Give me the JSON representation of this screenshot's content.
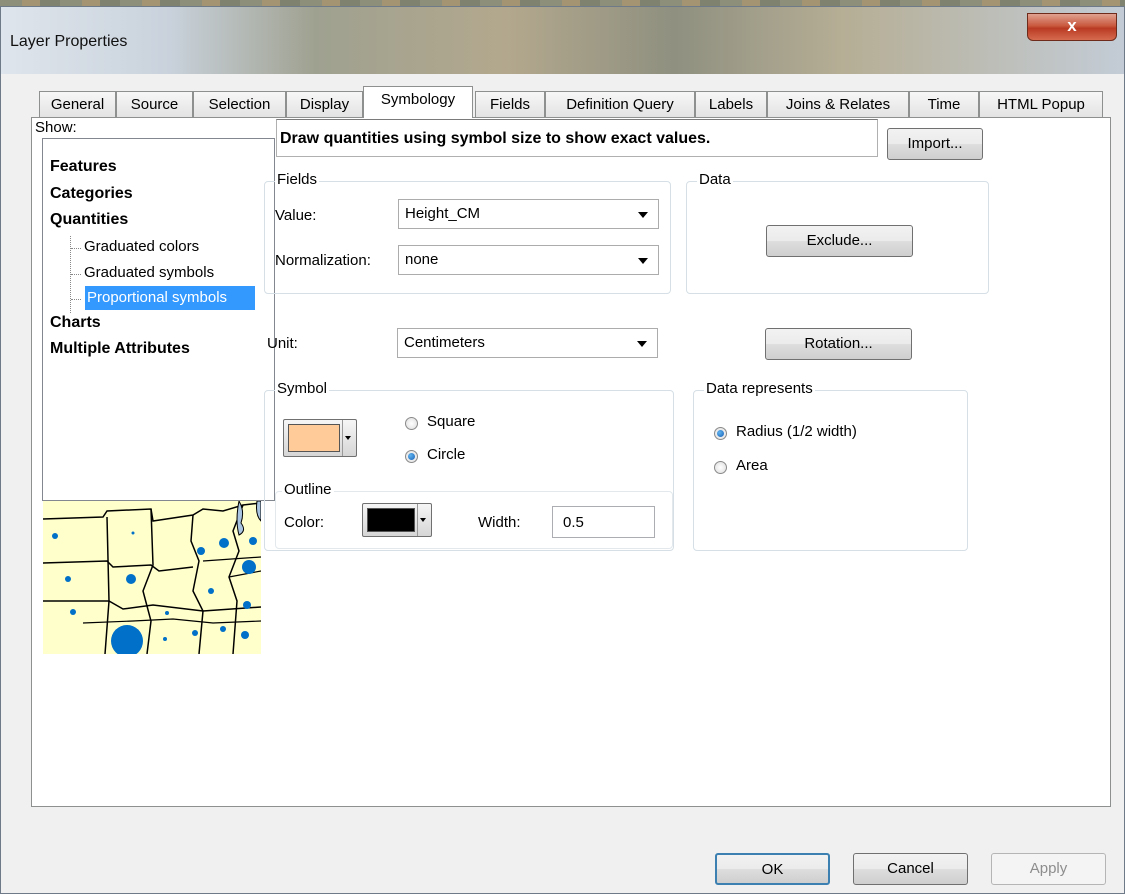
{
  "window": {
    "title": "Layer Properties",
    "close_glyph": "x",
    "close_color": "#c9593f"
  },
  "tabs": [
    {
      "label": "General",
      "active": false
    },
    {
      "label": "Source",
      "active": false
    },
    {
      "label": "Selection",
      "active": false
    },
    {
      "label": "Display",
      "active": false
    },
    {
      "label": "Symbology",
      "active": true
    },
    {
      "label": "Fields",
      "active": false
    },
    {
      "label": "Definition Query",
      "active": false
    },
    {
      "label": "Labels",
      "active": false
    },
    {
      "label": "Joins & Relates",
      "active": false
    },
    {
      "label": "Time",
      "active": false
    },
    {
      "label": "HTML Popup",
      "active": false
    }
  ],
  "show": {
    "label": "Show:",
    "items": [
      {
        "label": "Features",
        "level": 0
      },
      {
        "label": "Categories",
        "level": 0
      },
      {
        "label": "Quantities",
        "level": 0
      },
      {
        "label": "Graduated colors",
        "level": 1
      },
      {
        "label": "Graduated symbols",
        "level": 1
      },
      {
        "label": "Proportional symbols",
        "level": 1,
        "selected": true
      },
      {
        "label": "Charts",
        "level": 0
      },
      {
        "label": "Multiple Attributes",
        "level": 0
      }
    ],
    "selection_color": "#3399ff"
  },
  "description": "Draw quantities using symbol size to show exact values.",
  "import_label": "Import...",
  "fields": {
    "group_label": "Fields",
    "value_label": "Value:",
    "value": "Height_CM",
    "normalization_label": "Normalization:",
    "normalization": "none"
  },
  "data": {
    "group_label": "Data",
    "exclude_label": "Exclude..."
  },
  "unit": {
    "label": "Unit:",
    "value": "Centimeters"
  },
  "rotation_label": "Rotation...",
  "symbol": {
    "group_label": "Symbol",
    "fill_color": "#ffcc99",
    "square_label": "Square",
    "circle_label": "Circle",
    "selected_shape": "Circle",
    "outline": {
      "group_label": "Outline",
      "color_label": "Color:",
      "color": "#000000",
      "width_label": "Width:",
      "width": "0.5"
    }
  },
  "data_represents": {
    "group_label": "Data represents",
    "radius_label": "Radius (1/2 width)",
    "area_label": "Area",
    "selected": "Radius (1/2 width)"
  },
  "preview": {
    "land_color": "#ffffcc",
    "symbol_color": "#0070c8",
    "water_color": "#a8c4e0"
  },
  "buttons": {
    "ok": "OK",
    "cancel": "Cancel",
    "apply": "Apply"
  }
}
